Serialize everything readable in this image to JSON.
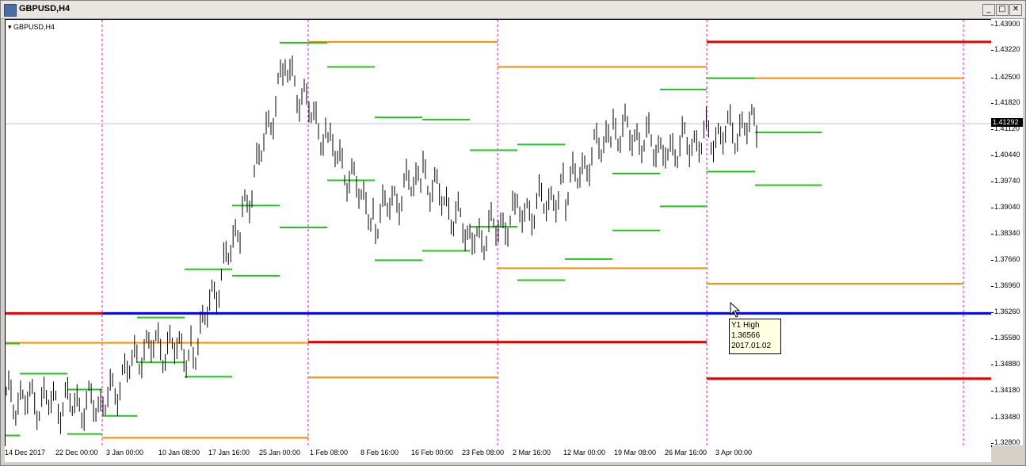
{
  "window": {
    "title": "GBPUSD,H4"
  },
  "chart": {
    "label": "GBPUSD,H4"
  },
  "price_axis": {
    "labels": [
      "1.43900",
      "1.43220",
      "1.42500",
      "1.41820",
      "1.41120",
      "1.40440",
      "1.39740",
      "1.39040",
      "1.38340",
      "1.37660",
      "1.36960",
      "1.36260",
      "1.35580",
      "1.34880",
      "1.34180",
      "1.33480",
      "1.32800"
    ],
    "current_price": "1.41292"
  },
  "time_axis": {
    "labels": [
      "14 Dec 2017",
      "22 Dec 00:00",
      "3 Jan 00:00",
      "10 Jan 08:00",
      "17 Jan 16:00",
      "25 Jan 00:00",
      "1 Feb 08:00",
      "8 Feb 16:00",
      "16 Feb 00:00",
      "23 Feb 08:00",
      "2 Mar 16:00",
      "12 Mar 00:00",
      "19 Mar 08:00",
      "26 Mar 16:00",
      "3 Apr 00:00"
    ]
  },
  "tooltip": {
    "line1": "Y1 High",
    "line2": "1.36566",
    "line3": "2017.01.02"
  },
  "colors": {
    "candles": "#000000",
    "support_green": "#22c322",
    "weekly_orange": "#ff8c00",
    "monthly_red": "#e60000",
    "yearly_blue": "#0000ff",
    "period_separator": "#ff00ff"
  },
  "chart_data": {
    "type": "line",
    "title": "GBPUSD,H4",
    "ylim": [
      1.328,
      1.439
    ],
    "series": [
      {
        "name": "GBPUSD,H4",
        "x": [
          "14 Dec 2017",
          "22 Dec 00:00",
          "3 Jan 00:00",
          "10 Jan 08:00",
          "17 Jan 16:00",
          "25 Jan 00:00",
          "1 Feb 08:00",
          "8 Feb 16:00",
          "16 Feb 00:00",
          "23 Feb 08:00",
          "2 Mar 16:00",
          "12 Mar 00:00",
          "19 Mar 08:00",
          "26 Mar 16:00",
          "3 Apr 00:00"
        ],
        "values": [
          1.34,
          1.338,
          1.354,
          1.353,
          1.388,
          1.428,
          1.408,
          1.388,
          1.4,
          1.382,
          1.388,
          1.395,
          1.412,
          1.406,
          1.4129
        ]
      }
    ]
  }
}
